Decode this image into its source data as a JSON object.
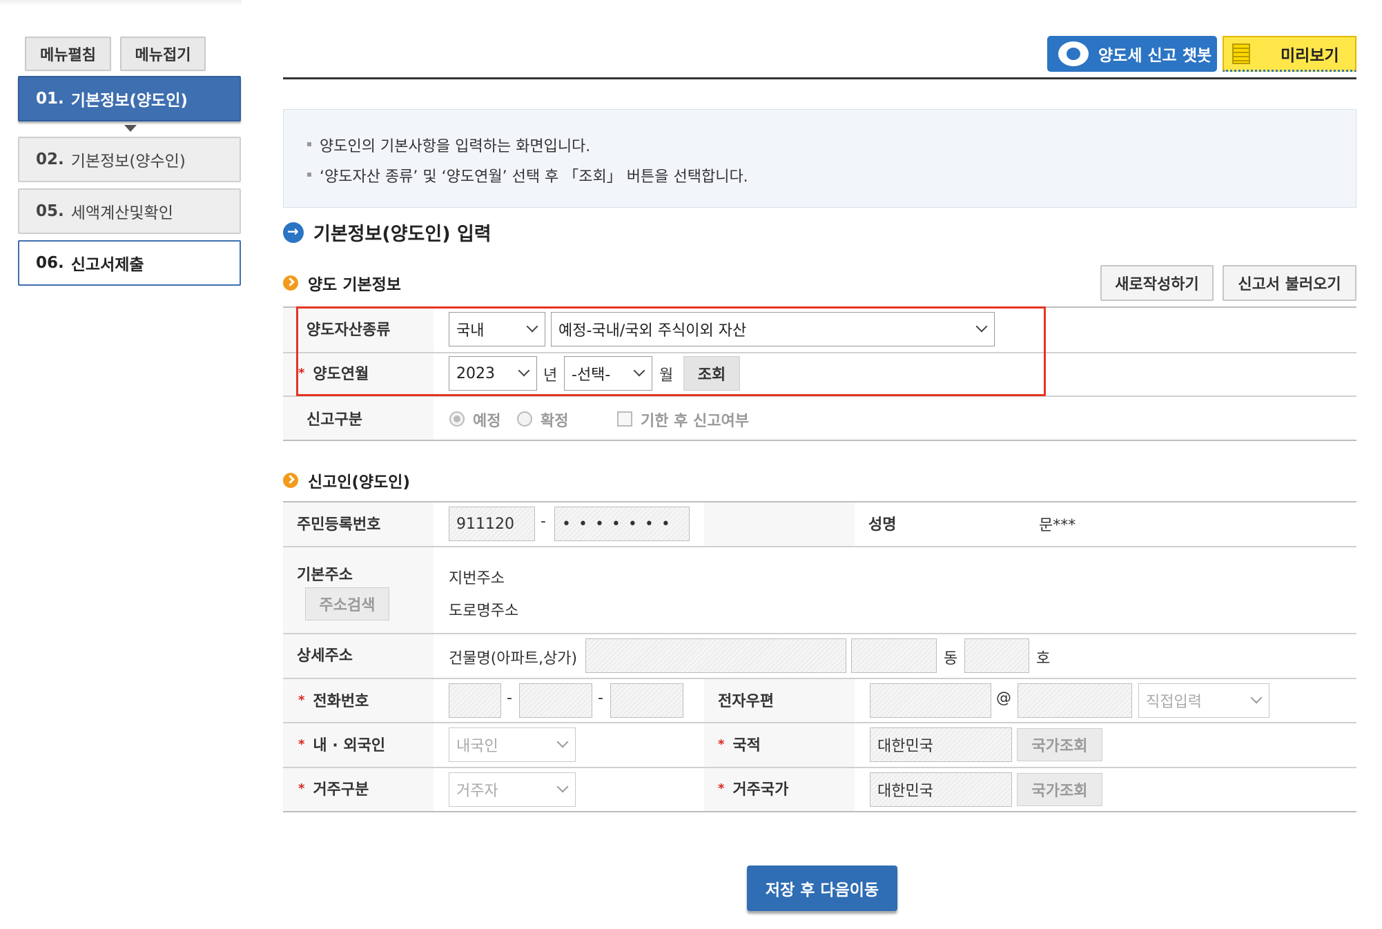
{
  "menu": {
    "expand_label": "메뉴펼침",
    "collapse_label": "메뉴접기"
  },
  "steps": [
    {
      "num": "01.",
      "label": "기본정보(양도인)"
    },
    {
      "num": "02.",
      "label": "기본정보(양수인)"
    },
    {
      "num": "05.",
      "label": "세액계산및확인"
    },
    {
      "num": "06.",
      "label": "신고서제출"
    }
  ],
  "toolbar": {
    "chatbot_label": "양도세 신고 챗봇",
    "preview_label": "미리보기"
  },
  "info": [
    "양도인의 기본사항을 입력하는 화면입니다.",
    "‘양도자산 종류’ 및 ‘양도연월’ 선택 후 「조회」 버튼을 선택합니다."
  ],
  "section_title": "기본정보(양도인) 입력",
  "transfer": {
    "title": "양도 기본정보",
    "new_button": "새로작성하기",
    "load_button": "신고서 불러오기",
    "asset_label": "양도자산종류",
    "asset_domestic": "국내",
    "asset_type": "예정-국내/국외 주식이외 자산",
    "month_label": "양도연월",
    "year": "2023",
    "year_unit": "년",
    "month": "-선택-",
    "month_unit": "월",
    "query_button": "조회",
    "report_label": "신고구분",
    "report_opt1": "예정",
    "report_opt2": "확정",
    "late_label": "기한 후 신고여부"
  },
  "reporter": {
    "title": "신고인(양도인)",
    "rrn_label": "주민등록번호",
    "rrn_front": "911120",
    "rrn_dash": "-",
    "rrn_back": "• • • • • • •",
    "name_label": "성명",
    "name_value": "문***",
    "addr_label": "기본주소",
    "addr_search": "주소검색",
    "lot_addr": "지번주소",
    "road_addr": "도로명주소",
    "detail_label": "상세주소",
    "building_label": "건물명(아파트,상가)",
    "dong": "동",
    "ho": "호",
    "phone_label": "전화번호",
    "phone_dash": "-",
    "email_label": "전자우편",
    "email_at": "@",
    "email_domain": "직접입력",
    "foreign_label": "내 · 외국인",
    "foreign_value": "내국인",
    "nation_label": "국적",
    "nation_value": "대한민국",
    "nation_btn": "국가조회",
    "residence_label": "거주구분",
    "residence_value": "거주자",
    "res_country_label": "거주국가",
    "res_country_value": "대한민국",
    "res_country_btn": "국가조회"
  },
  "submit_label": "저장 후 다음이동",
  "colors": {
    "primary": "#2c74c4",
    "step_active": "#3e6fb0",
    "highlight": "#e53323",
    "preview": "#ffe74a",
    "required": "#d9251d"
  }
}
